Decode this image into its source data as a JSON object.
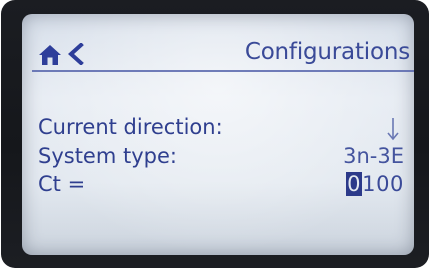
{
  "header": {
    "title": "Configurations",
    "home_icon": "home-icon",
    "back_icon": "chevron-left-icon"
  },
  "settings": [
    {
      "label": "Current direction:",
      "value": "↓",
      "value_icon": "arrow-down-icon"
    },
    {
      "label": "System type:",
      "value": "3n-3E"
    },
    {
      "label": "Ct =",
      "value": "0100",
      "selected_digit": "0",
      "remaining_digits": "100"
    }
  ],
  "colors": {
    "screen_text": "#2e3e8e",
    "screen_background": "#e3e9f0",
    "bezel": "#15171b",
    "cursor_highlight": "#2c3a8a"
  }
}
